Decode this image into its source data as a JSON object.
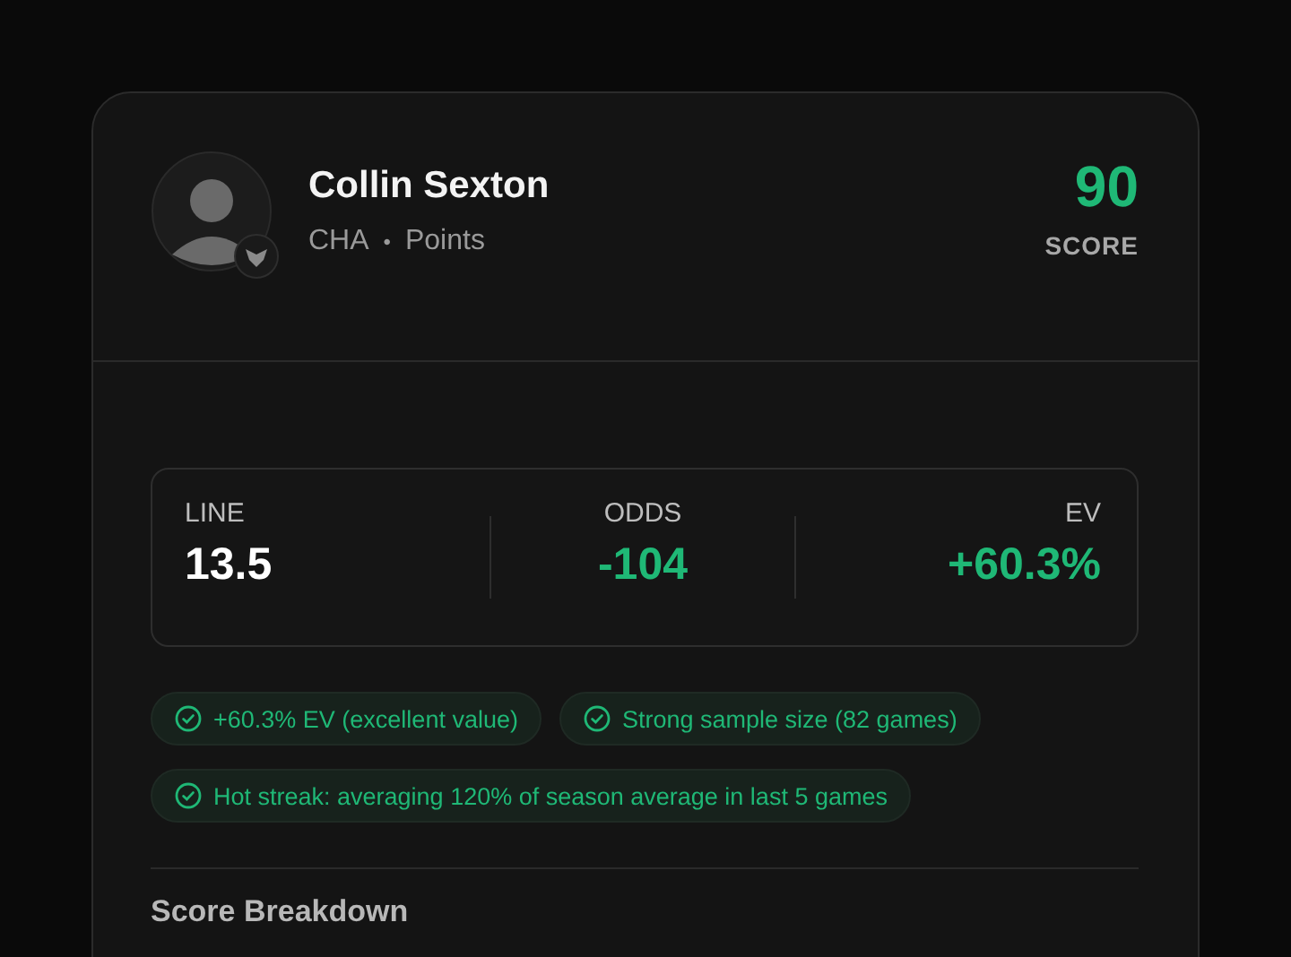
{
  "player": {
    "name": "Collin Sexton",
    "team": "CHA",
    "separator": "•",
    "market": "Points"
  },
  "score": {
    "value": "90",
    "label": "SCORE"
  },
  "stats": [
    {
      "label": "LINE",
      "value": "13.5",
      "color": "#ffffff"
    },
    {
      "label": "ODDS",
      "value": "-104",
      "color": "#1fb876"
    },
    {
      "label": "EV",
      "value": "+60.3%",
      "color": "#1fb876"
    }
  ],
  "reasons": [
    {
      "text": "+60.3% EV (excellent value)"
    },
    {
      "text": "Strong sample size (82 games)"
    },
    {
      "text": "Hot streak: averaging 120% of season average in last 5 games"
    }
  ],
  "section_title": "Score Breakdown"
}
